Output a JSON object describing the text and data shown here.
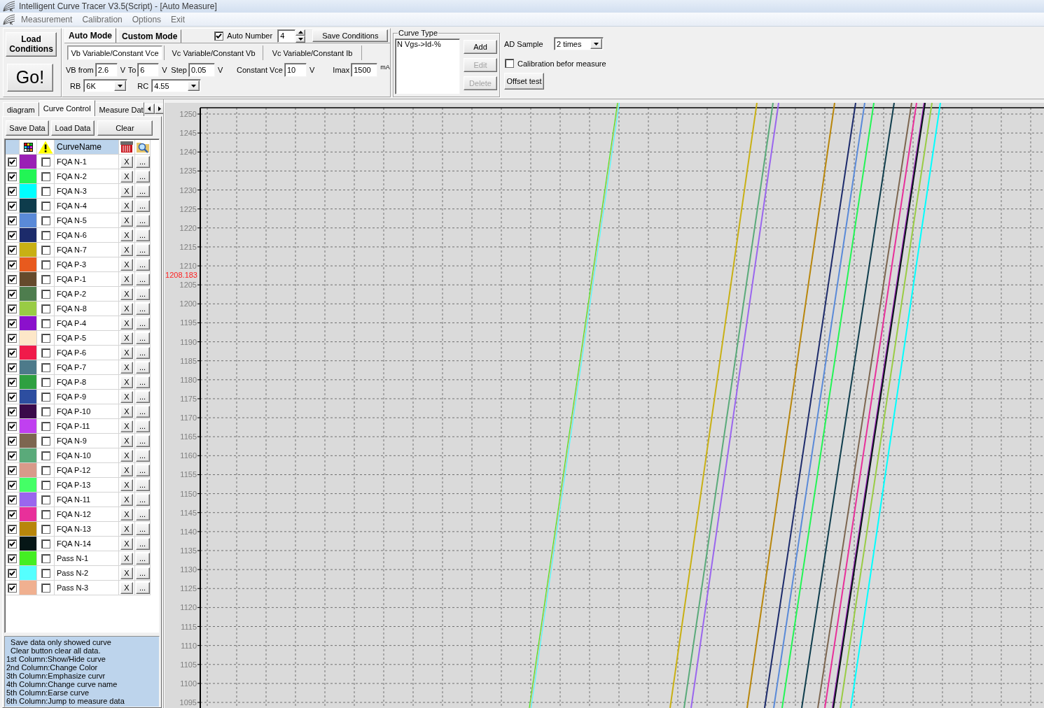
{
  "window": {
    "title": "Intelligent Curve Tracer V3.5(Script) - [Auto Measure]"
  },
  "menu": [
    {
      "label": "Measurement"
    },
    {
      "label": "Calibration"
    },
    {
      "label": "Options"
    },
    {
      "label": "Exit"
    }
  ],
  "toolbar": {
    "load_button": "Load Conditions",
    "go_button": "Go!",
    "mode_tabs": [
      {
        "label": "Auto Mode",
        "selected": true
      },
      {
        "label": "Custom Mode",
        "selected": false
      }
    ],
    "auto_number": {
      "label": "Auto Number",
      "checked": true,
      "value": "4"
    },
    "save_conditions_button": "Save Conditions",
    "sweep_tabs": [
      {
        "label": "Vb Variable/Constant Vce",
        "selected": true
      },
      {
        "label": "Vc Variable/Constant Vb",
        "selected": false
      },
      {
        "label": "Vc Variable/Constant Ib",
        "selected": false
      }
    ],
    "parameters": [
      {
        "label": "VB from",
        "value": "2.6",
        "unit": "V"
      },
      {
        "label": "To",
        "value": "6",
        "unit": "V"
      },
      {
        "label": "Step",
        "value": "0.05",
        "unit": "V"
      },
      {
        "label": "Constant Vce",
        "value": "10",
        "unit": "V"
      },
      {
        "label": "Imax",
        "value": "1500",
        "unit": "mA"
      }
    ],
    "resistors": [
      {
        "label": "RB",
        "value": "6K"
      },
      {
        "label": "RC",
        "value": "4.55"
      }
    ],
    "curve_type": {
      "title": "Curve Type",
      "items": [
        {
          "label": "N Vgs->Id-%",
          "selected": false
        }
      ],
      "buttons": [
        {
          "label": "Add",
          "disabled": false
        },
        {
          "label": "Edit",
          "disabled": true
        },
        {
          "label": "Delete",
          "disabled": true
        }
      ]
    },
    "ad_sample": {
      "label": "AD Sample",
      "value": "2 times"
    },
    "calibration": {
      "label": "Calibration befor measure",
      "checked": false
    },
    "offset_test_button": "Offset test"
  },
  "side_panel": {
    "tabs": [
      {
        "label": "diagram",
        "selected": false
      },
      {
        "label": "Curve Control",
        "selected": true
      },
      {
        "label": "Measure Dat",
        "selected": false
      }
    ],
    "buttons": [
      {
        "label": "Save Data"
      },
      {
        "label": "Load Data"
      },
      {
        "label": "Clear"
      }
    ],
    "curve_table": {
      "name_header": "CurveName",
      "rows": [
        {
          "shown": true,
          "color": "#9a1fb5",
          "emphasized": false,
          "name": "FQA N-1",
          "erase_label": "X",
          "jump_label": "..."
        },
        {
          "shown": true,
          "color": "#22f555",
          "emphasized": false,
          "name": "FQA N-2",
          "erase_label": "X",
          "jump_label": "..."
        },
        {
          "shown": true,
          "color": "#00ffff",
          "emphasized": false,
          "name": "FQA N-3",
          "erase_label": "X",
          "jump_label": "..."
        },
        {
          "shown": true,
          "color": "#0e3c4c",
          "emphasized": false,
          "name": "FQA N-4",
          "erase_label": "X",
          "jump_label": "..."
        },
        {
          "shown": true,
          "color": "#5a8ad8",
          "emphasized": false,
          "name": "FQA N-5",
          "erase_label": "X",
          "jump_label": "..."
        },
        {
          "shown": true,
          "color": "#1c2b6b",
          "emphasized": false,
          "name": "FQA N-6",
          "erase_label": "X",
          "jump_label": "..."
        },
        {
          "shown": true,
          "color": "#c8b014",
          "emphasized": false,
          "name": "FQA N-7",
          "erase_label": "X",
          "jump_label": "..."
        },
        {
          "shown": true,
          "color": "#e85a1e",
          "emphasized": false,
          "name": "FQA P-3",
          "erase_label": "X",
          "jump_label": "..."
        },
        {
          "shown": true,
          "color": "#654a2c",
          "emphasized": false,
          "name": "FQA P-1",
          "erase_label": "X",
          "jump_label": "..."
        },
        {
          "shown": true,
          "color": "#4e7d4e",
          "emphasized": false,
          "name": "FQA P-2",
          "erase_label": "X",
          "jump_label": "..."
        },
        {
          "shown": true,
          "color": "#99cc44",
          "emphasized": false,
          "name": "FQA N-8",
          "erase_label": "X",
          "jump_label": "..."
        },
        {
          "shown": true,
          "color": "#8b10cc",
          "emphasized": false,
          "name": "FQA P-4",
          "erase_label": "X",
          "jump_label": "..."
        },
        {
          "shown": true,
          "color": "#fde7c8",
          "emphasized": false,
          "name": "FQA P-5",
          "erase_label": "X",
          "jump_label": "..."
        },
        {
          "shown": true,
          "color": "#f01a4a",
          "emphasized": false,
          "name": "FQA P-6",
          "erase_label": "X",
          "jump_label": "..."
        },
        {
          "shown": true,
          "color": "#4d7a8a",
          "emphasized": false,
          "name": "FQA P-7",
          "erase_label": "X",
          "jump_label": "..."
        },
        {
          "shown": true,
          "color": "#2ea040",
          "emphasized": false,
          "name": "FQA P-8",
          "erase_label": "X",
          "jump_label": "..."
        },
        {
          "shown": true,
          "color": "#2d4ea0",
          "emphasized": false,
          "name": "FQA P-9",
          "erase_label": "X",
          "jump_label": "..."
        },
        {
          "shown": true,
          "color": "#3a0a4a",
          "emphasized": false,
          "name": "FQA P-10",
          "erase_label": "X",
          "jump_label": "..."
        },
        {
          "shown": true,
          "color": "#c040f0",
          "emphasized": false,
          "name": "FQA P-11",
          "erase_label": "X",
          "jump_label": "..."
        },
        {
          "shown": true,
          "color": "#7d6650",
          "emphasized": false,
          "name": "FQA N-9",
          "erase_label": "X",
          "jump_label": "..."
        },
        {
          "shown": true,
          "color": "#5aaa7a",
          "emphasized": false,
          "name": "FQA N-10",
          "erase_label": "X",
          "jump_label": "..."
        },
        {
          "shown": true,
          "color": "#d89a8a",
          "emphasized": false,
          "name": "FQA P-12",
          "erase_label": "X",
          "jump_label": "..."
        },
        {
          "shown": true,
          "color": "#44ff66",
          "emphasized": false,
          "name": "FQA P-13",
          "erase_label": "X",
          "jump_label": "..."
        },
        {
          "shown": true,
          "color": "#9a66ee",
          "emphasized": false,
          "name": "FQA N-11",
          "erase_label": "X",
          "jump_label": "..."
        },
        {
          "shown": true,
          "color": "#e8309a",
          "emphasized": false,
          "name": "FQA N-12",
          "erase_label": "X",
          "jump_label": "..."
        },
        {
          "shown": true,
          "color": "#b8860b",
          "emphasized": false,
          "name": "FQA N-13",
          "erase_label": "X",
          "jump_label": "..."
        },
        {
          "shown": true,
          "color": "#061616",
          "emphasized": false,
          "name": "FQA N-14",
          "erase_label": "X",
          "jump_label": "..."
        },
        {
          "shown": true,
          "color": "#44ee22",
          "emphasized": false,
          "name": "Pass N-1",
          "erase_label": "X",
          "jump_label": "..."
        },
        {
          "shown": true,
          "color": "#55ffff",
          "emphasized": false,
          "name": "Pass N-2",
          "erase_label": "X",
          "jump_label": "..."
        },
        {
          "shown": true,
          "color": "#f0b090",
          "emphasized": false,
          "name": "Pass N-3",
          "erase_label": "X",
          "jump_label": "..."
        }
      ]
    },
    "help_lines": [
      "  Save data only showed curve",
      "  Clear button clear all data.",
      "1st Column:Show/Hide curve",
      "2nd Column:Change Color",
      "3th Column:Emphasize curvr",
      "4th Column:Change curve name",
      "5th Column:Earse curve",
      "6th Column:Jump to measure data"
    ]
  },
  "plot": {
    "y_tick_labels": [
      "1250",
      "1245",
      "1240",
      "1235",
      "1230",
      "1225",
      "1220",
      "1215",
      "1210",
      "1205",
      "1200",
      "1195",
      "1190",
      "1185",
      "1180",
      "1175",
      "1170",
      "1165",
      "1160",
      "1155",
      "1150",
      "1145",
      "1140",
      "1135",
      "1130",
      "1125",
      "1120",
      "1115",
      "1110",
      "1105",
      "1100",
      "1095"
    ],
    "cursor_value": "1208.183"
  }
}
